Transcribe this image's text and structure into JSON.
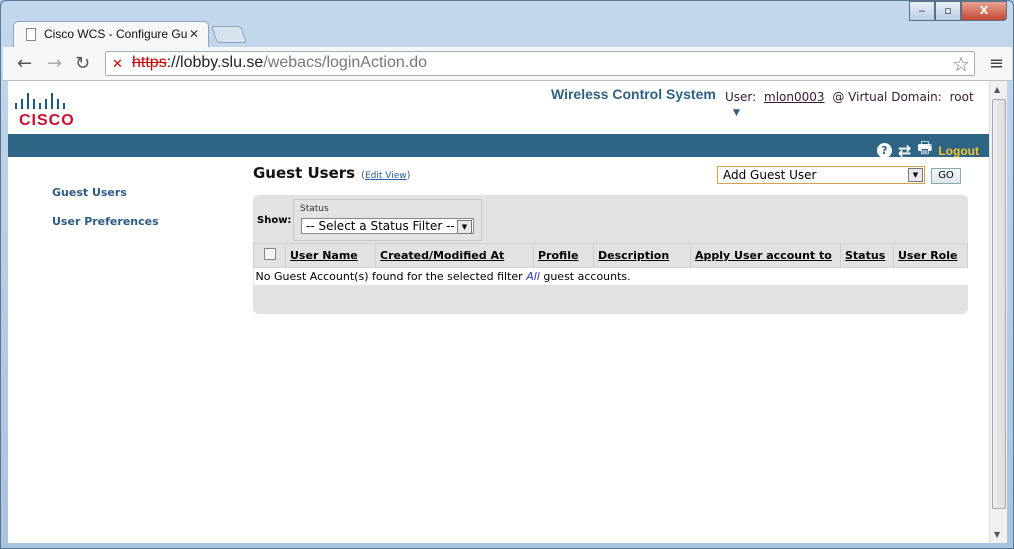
{
  "browser": {
    "tab_title": "Cisco WCS - Configure Gu",
    "url_scheme": "https",
    "url_host": "://lobby.slu.se",
    "url_path": "/webacs/loginAction.do"
  },
  "header": {
    "logo_text": "CISCO",
    "app_title": "Wireless Control System",
    "user_label": "User:",
    "username": "mlon0003",
    "domain_label": "@ Virtual Domain:",
    "domain": "root",
    "logout": "Logout"
  },
  "sidebar": {
    "items": [
      {
        "label": "Guest Users"
      },
      {
        "label": "User Preferences"
      }
    ]
  },
  "main": {
    "title": "Guest Users",
    "edit_view": "Edit View",
    "action_select": "Add Guest User",
    "go": "GO",
    "show_label": "Show:",
    "status_label": "Status",
    "status_filter": "-- Select a Status Filter --",
    "columns": [
      "User Name",
      "Created/Modified At",
      "Profile",
      "Description",
      "Apply User account to",
      "Status",
      "User Role"
    ],
    "empty_prefix": "No Guest Account(s) found for the selected filter",
    "empty_filter": "All",
    "empty_suffix": "guest accounts."
  }
}
